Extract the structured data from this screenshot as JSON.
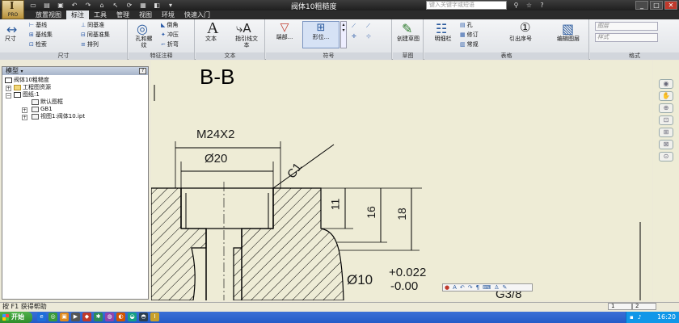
{
  "app": {
    "logo_text": "PRO",
    "title": "阀体10粗糙度",
    "help_search_placeholder": "键入关键字或短语"
  },
  "tabs": [
    "放置视图",
    "标注",
    "工具",
    "管理",
    "视图",
    "环境",
    "快速入门"
  ],
  "active_tab": "标注",
  "ribbon": {
    "dimension": {
      "dim_label": "尺寸",
      "baseline_label": "基线",
      "baseline_set_label": "基线集",
      "ordinate_label": "同基准",
      "ordinate_set_label": "同基准集",
      "check_label": "检索",
      "arrange_label": "排列",
      "panel_title": "尺寸"
    },
    "feature_notes": {
      "hole_thread_label": "孔和螺纹",
      "chamfer_label": "倒角",
      "punch_label": "冲压",
      "bend_label": "折弯",
      "panel_title": "特征注释"
    },
    "text": {
      "text_label": "文本",
      "leader_text_label": "指引线文本",
      "panel_title": "文本"
    },
    "symbols": {
      "surface_label": "端部...",
      "form_label": "形位...",
      "panel_title": "符号"
    },
    "sketch": {
      "create_sketch_label": "创建草图",
      "panel_title": "草图"
    },
    "table": {
      "detail_label": "明细栏",
      "hole_label": "孔",
      "revision_label": "修订",
      "general_label": "常规",
      "panel_title": "表格"
    },
    "balloon": {
      "balloon_label": "引出序号"
    },
    "format": {
      "edit_layer_label": "编辑图层",
      "layer_select": "图层",
      "style_select": "样式",
      "panel_title": "格式"
    }
  },
  "browser": {
    "title": "模型",
    "help_icon": "?",
    "items": [
      {
        "label": "阀体10粗糙度"
      },
      {
        "label": "工程图资源"
      },
      {
        "label": "图纸:1"
      },
      {
        "label": "默认图框"
      },
      {
        "label": "GB1"
      },
      {
        "label": "视图1:阀体10.ipt"
      }
    ]
  },
  "drawing": {
    "section_label": "B-B",
    "thread_dim": "M24X2",
    "dia20": "Ø20",
    "chamfer": "C1",
    "dim11": "11",
    "dim16": "16",
    "dim18": "18",
    "dia10": "Ø10",
    "tol_upper": "+0.022",
    "tol_lower": "-0.00",
    "thread_g": "G3/8",
    "background_color": "#eeecd6",
    "line_color": "#000000"
  },
  "status": {
    "help_text": "按 F1 获得帮助",
    "sheet_nums": [
      "1",
      "2"
    ]
  },
  "taskbar": {
    "start_label": "开始",
    "clock": "16:20"
  }
}
